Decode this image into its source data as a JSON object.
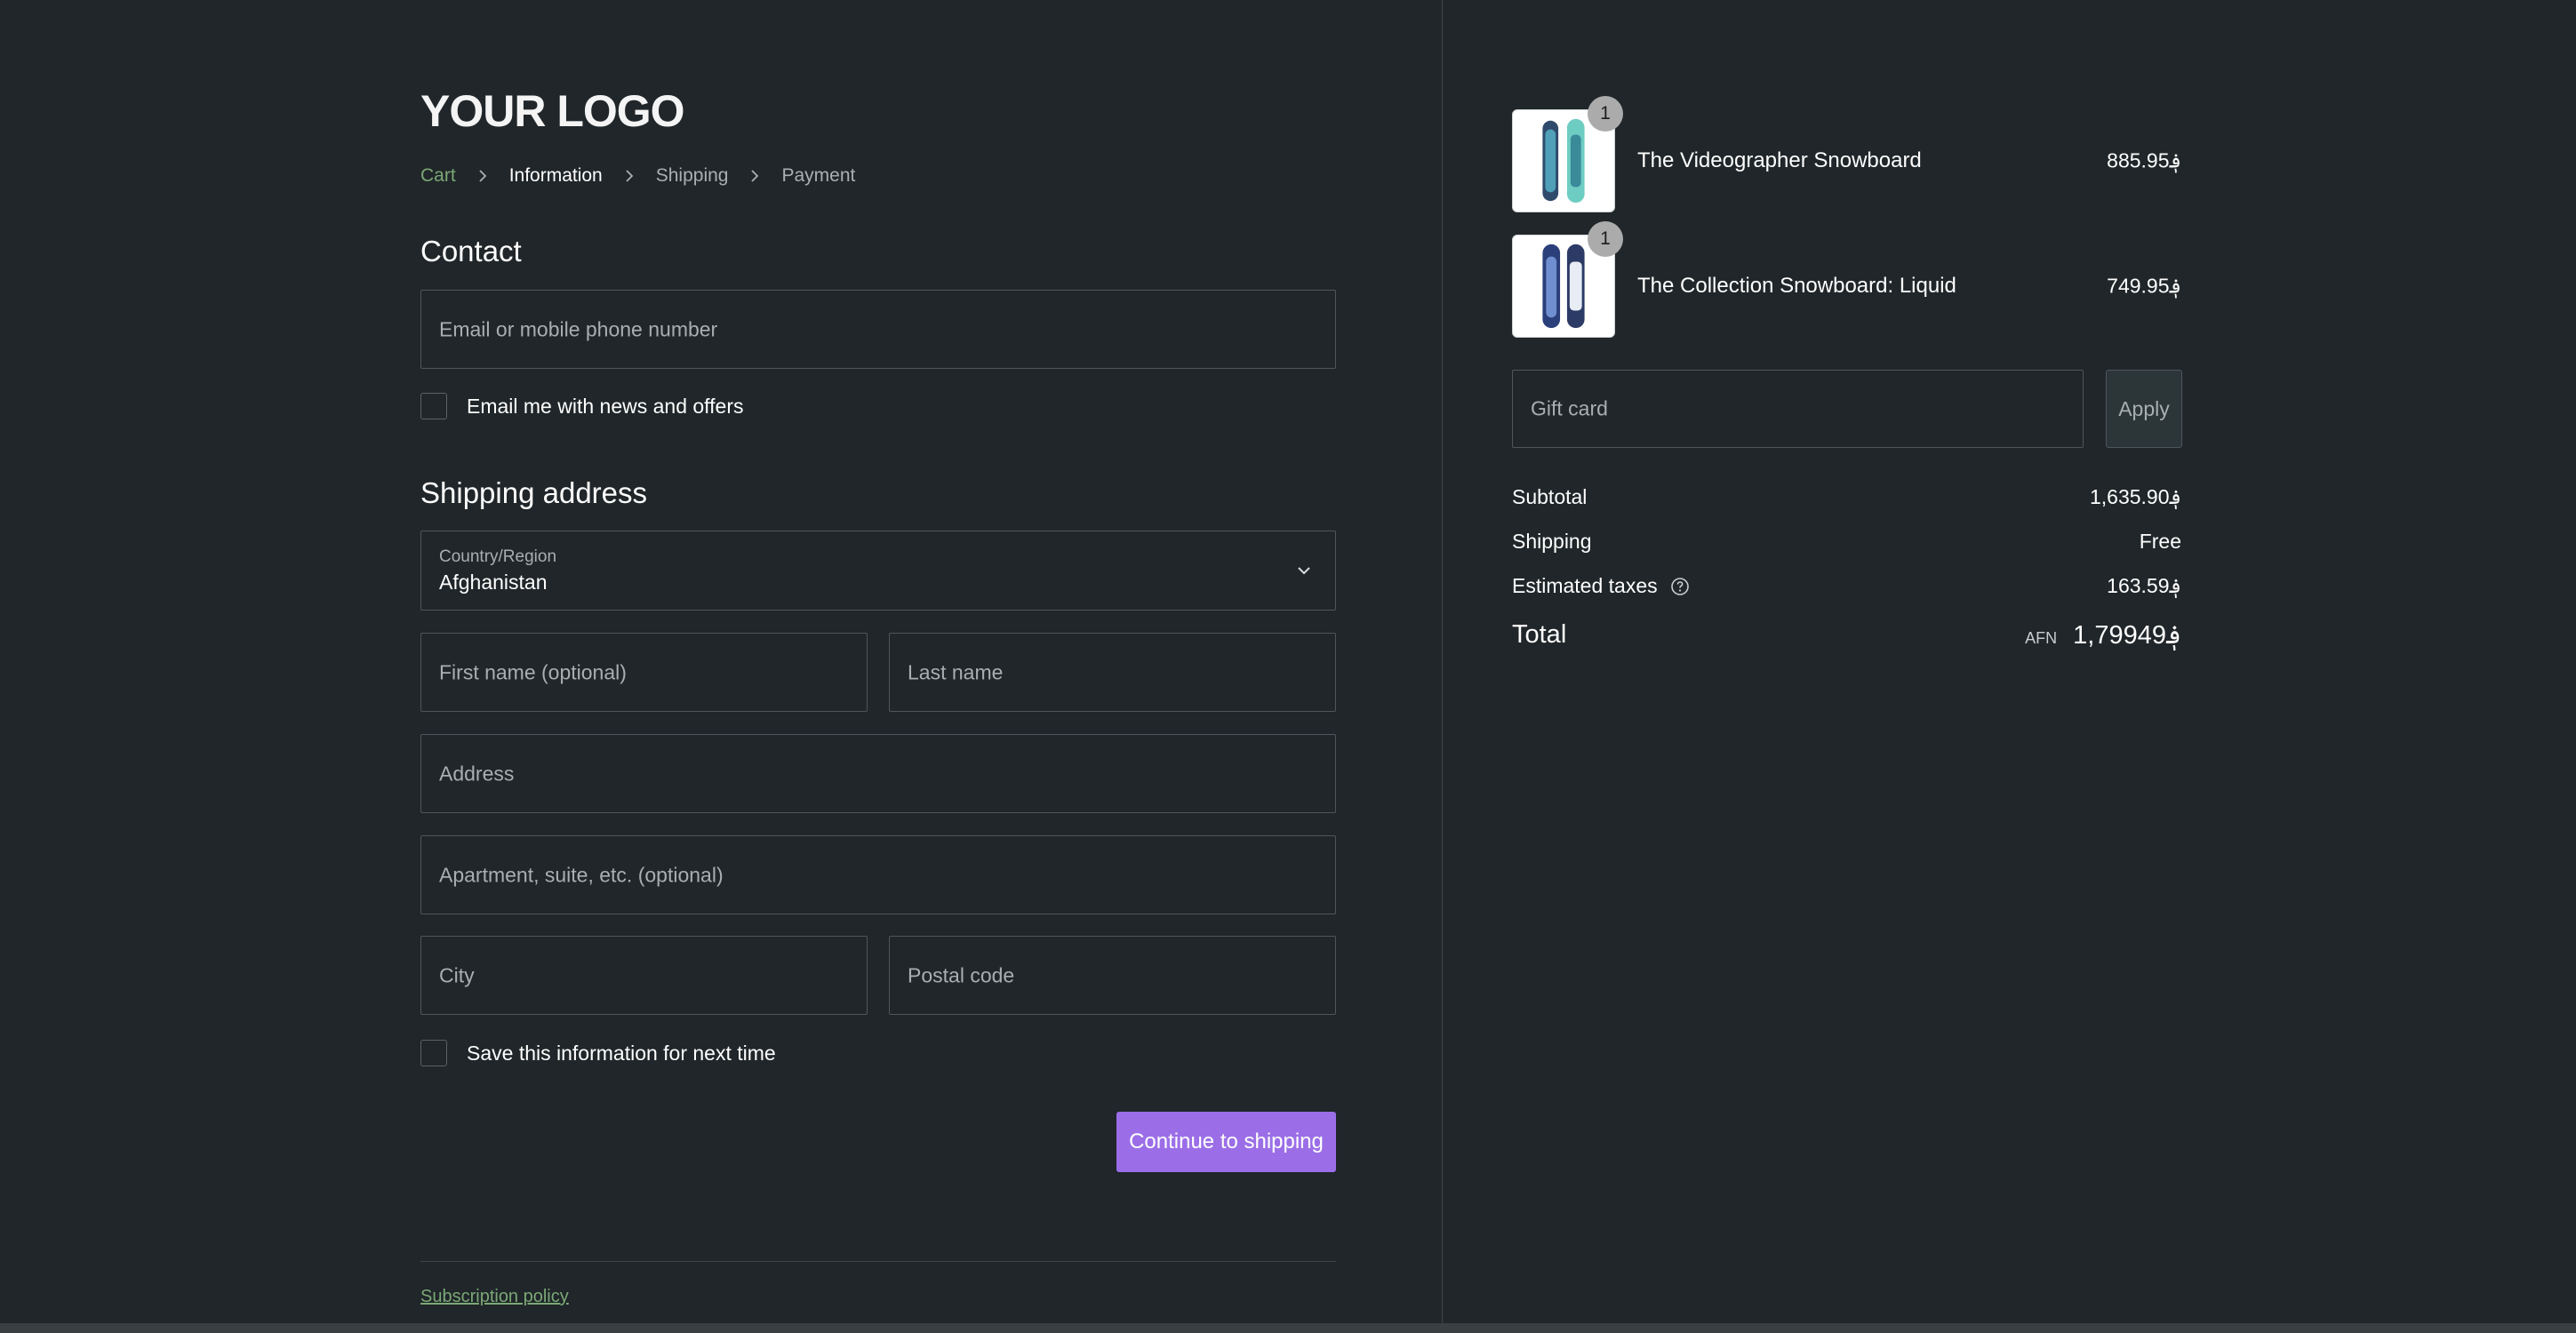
{
  "brand": {
    "logo_text": "YOUR LOGO"
  },
  "breadcrumb": {
    "items": [
      {
        "label": "Cart"
      },
      {
        "label": "Information"
      },
      {
        "label": "Shipping"
      },
      {
        "label": "Payment"
      }
    ]
  },
  "contact": {
    "title": "Contact",
    "email_placeholder": "Email or mobile phone number",
    "newsletter_label": "Email me with news and offers",
    "newsletter_checked": false
  },
  "shipping": {
    "title": "Shipping address",
    "country_label": "Country/Region",
    "country_value": "Afghanistan",
    "first_name_placeholder": "First name (optional)",
    "last_name_placeholder": "Last name",
    "address_placeholder": "Address",
    "apartment_placeholder": "Apartment, suite, etc. (optional)",
    "city_placeholder": "City",
    "postal_placeholder": "Postal code",
    "save_info_label": "Save this information for next time",
    "save_info_checked": false,
    "continue_label": "Continue to shipping"
  },
  "footer": {
    "policy_link": "Subscription policy"
  },
  "order": {
    "items": [
      {
        "title": "The Videographer Snowboard",
        "price": "885.95؋",
        "quantity": "1"
      },
      {
        "title": "The Collection Snowboard: Liquid",
        "price": "749.95؋",
        "quantity": "1"
      }
    ],
    "gift_card_placeholder": "Gift card",
    "apply_label": "Apply",
    "subtotal_label": "Subtotal",
    "subtotal_value": "1,635.90؋",
    "shipping_label": "Shipping",
    "shipping_value": "Free",
    "taxes_label": "Estimated taxes",
    "taxes_value": "163.59؋",
    "total_label": "Total",
    "currency_code": "AFN",
    "total_value": "1,79949؋"
  },
  "colors": {
    "background": "#202629",
    "accent_green": "#7ca877",
    "primary_button": "#9b6ee8",
    "field_border": "#4e575b"
  },
  "icons": [
    "chevron-right-icon",
    "chevron-down-icon",
    "info-circle-icon"
  ]
}
